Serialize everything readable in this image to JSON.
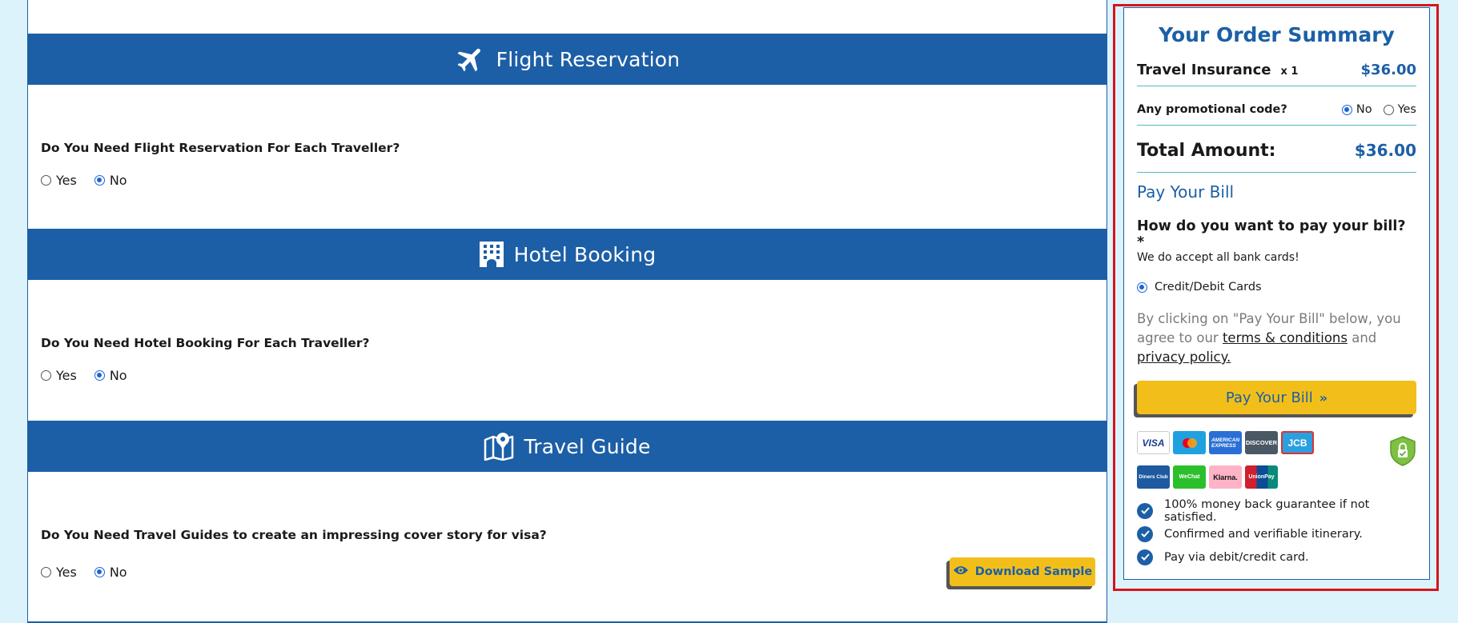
{
  "sections": [
    {
      "icon": "airplane-icon",
      "title": "Flight Reservation",
      "question": "Do You Need Flight Reservation For Each Traveller?",
      "options": [
        "Yes",
        "No"
      ],
      "selected": "No"
    },
    {
      "icon": "hotel-building-icon",
      "title": "Hotel Booking",
      "question": "Do You Need Hotel Booking For Each Traveller?",
      "options": [
        "Yes",
        "No"
      ],
      "selected": "No"
    },
    {
      "icon": "map-pin-icon",
      "title": "Travel Guide",
      "question": "Do You Need Travel Guides to create an impressing cover story for visa?",
      "options": [
        "Yes",
        "No"
      ],
      "selected": "No",
      "download_label": "Download Sample"
    }
  ],
  "summary": {
    "title": "Your Order Summary",
    "item_name": "Travel Insurance",
    "item_qty": "x 1",
    "item_price": "$36.00",
    "promo_label": "Any promotional code?",
    "promo_options": [
      "No",
      "Yes"
    ],
    "promo_selected": "No",
    "total_label": "Total Amount:",
    "total_value": "$36.00",
    "pay_heading": "Pay Your Bill",
    "pay_question": "How do you want to pay your bill? *",
    "cards_note": "We do accept all bank cards!",
    "method_label": "Credit/Debit Cards",
    "terms_prefix": "By clicking on \"Pay Your Bill\" below, you agree to our",
    "terms_link": "terms & conditions",
    "terms_and": "and",
    "privacy_link": "privacy policy.",
    "pay_button": "Pay Your Bill",
    "cards": [
      "VISA",
      "Mastercard",
      "American Express",
      "DISCOVER",
      "JCB",
      "Diners Club",
      "WeChat",
      "Klarna.",
      "UnionPay"
    ],
    "guarantees": [
      "100% money back guarantee if not satisfied.",
      "Confirmed and verifiable itinerary.",
      "Pay via debit/credit card."
    ]
  },
  "colors": {
    "brand_blue": "#1c5fa6",
    "accent_yellow": "#f2bf1a",
    "highlight_red": "#d8141b"
  }
}
